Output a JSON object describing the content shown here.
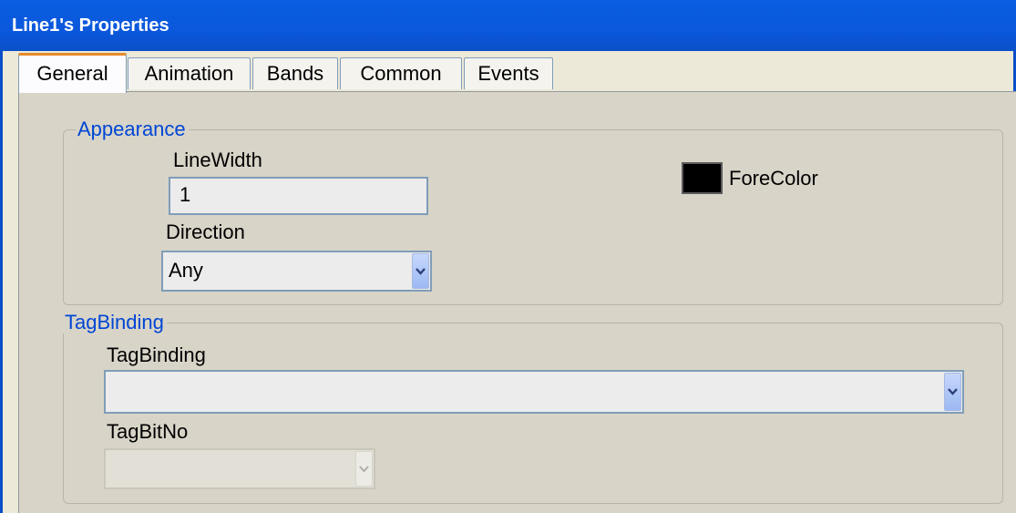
{
  "window": {
    "title": "Line1's Properties"
  },
  "tabs": [
    {
      "label": "General",
      "active": true
    },
    {
      "label": "Animation"
    },
    {
      "label": "Bands"
    },
    {
      "label": "Common"
    },
    {
      "label": "Events"
    }
  ],
  "appearance": {
    "legend": "Appearance",
    "line_width_label": "LineWidth",
    "line_width_value": "1",
    "direction_label": "Direction",
    "direction_value": "Any",
    "fore_color_label": "ForeColor",
    "fore_color": "#000000"
  },
  "tag_binding": {
    "legend": "TagBinding",
    "tag_binding_label": "TagBinding",
    "tag_binding_value": "",
    "tag_bit_no_label": "TagBitNo",
    "tag_bit_no_value": ""
  },
  "colors": {
    "title_bar": "#0a5de0",
    "accent_tab": "#e68b2c",
    "legend_text": "#0046d5",
    "panel_bg": "#d8d4c8"
  }
}
